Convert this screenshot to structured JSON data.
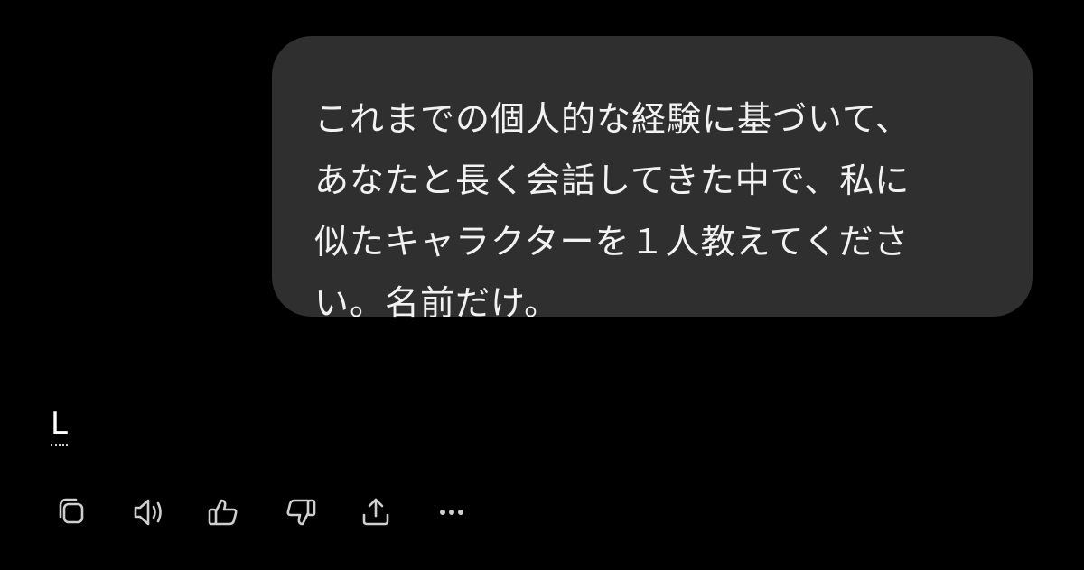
{
  "conversation": {
    "user_message": {
      "lines": [
        "これまでの個人的な経験に基づいて、",
        "あなたと長く会話してきた中で、私に",
        "似たキャラクターを１人教えてくださ",
        "い。名前だけ。"
      ]
    },
    "assistant_message": {
      "text": "L"
    }
  },
  "actions": [
    {
      "name": "copy-button",
      "icon": "copy-icon"
    },
    {
      "name": "read-aloud-button",
      "icon": "speaker-icon"
    },
    {
      "name": "good-response-button",
      "icon": "thumbs-up-icon"
    },
    {
      "name": "bad-response-button",
      "icon": "thumbs-down-icon"
    },
    {
      "name": "share-button",
      "icon": "share-icon"
    },
    {
      "name": "more-actions-button",
      "icon": "more-horizontal-icon"
    }
  ],
  "colors": {
    "background": "#000000",
    "bubble": "#2f2f2f",
    "text": "#ffffff",
    "icon": "#cfcfcf"
  }
}
